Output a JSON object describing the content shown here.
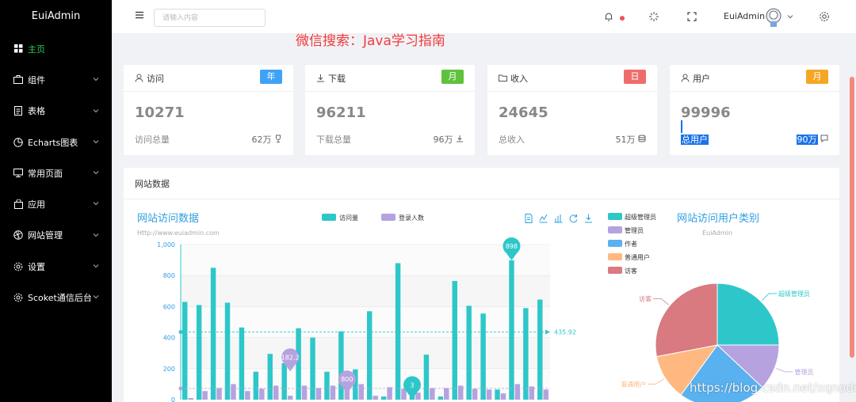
{
  "app": {
    "name": "EuiAdmin"
  },
  "sidebar": {
    "items": [
      {
        "label": "主页",
        "icon": "grid-icon",
        "active": true
      },
      {
        "label": "组件",
        "icon": "briefcase-icon"
      },
      {
        "label": "表格",
        "icon": "table-icon"
      },
      {
        "label": "Echarts图表",
        "icon": "pie-chart-icon"
      },
      {
        "label": "常用页面",
        "icon": "monitor-icon"
      },
      {
        "label": "应用",
        "icon": "bag-icon"
      },
      {
        "label": "网站管理",
        "icon": "aperture-icon"
      },
      {
        "label": "设置",
        "icon": "gear-icon"
      },
      {
        "label": "Scoket通信后台",
        "icon": "settings-icon"
      }
    ],
    "active_color": "#2ccd4f",
    "background": "#000000"
  },
  "header": {
    "search_placeholder": "请输入内容",
    "user_name": "EuiAdmin",
    "notice_dot_color": "#f0505a"
  },
  "banner_text": "微信搜索：Java学习指南",
  "stats": [
    {
      "title": "访问",
      "icon": "user-icon",
      "tag": "年",
      "tag_color": "#3fa2f7",
      "value": "10271",
      "label": "访问总量",
      "sub_value": "62万",
      "sub_icon": "trophy-icon"
    },
    {
      "title": "下载",
      "icon": "download-icon",
      "tag": "月",
      "tag_color": "#5fc23d",
      "value": "96211",
      "label": "下载总量",
      "sub_value": "96万",
      "sub_icon": "download-icon"
    },
    {
      "title": "收入",
      "icon": "folder-icon",
      "tag": "日",
      "tag_color": "#f06c6c",
      "value": "24645",
      "label": "总收入",
      "sub_value": "51万",
      "sub_icon": "database-icon"
    },
    {
      "title": "用户",
      "icon": "user-icon",
      "tag": "月",
      "tag_color": "#f5a623",
      "value": "99996",
      "label": "总用户",
      "sub_value": "90万",
      "sub_icon": "message-icon"
    }
  ],
  "panel": {
    "title": "网站数据"
  },
  "bar_chart": {
    "title": "网站访问数据",
    "subtitle": "Http://www.euiadmin.com",
    "legend": [
      "访问量",
      "登录人数"
    ],
    "toolbox_icons": [
      "data-view-icon",
      "line-chart-icon",
      "bar-chart-icon",
      "restore-icon",
      "save-image-icon"
    ],
    "avg_label": "435.92",
    "markers": [
      {
        "label": "898",
        "color": "#2ec7c9"
      },
      {
        "label": "182.2",
        "color": "#b6a2de"
      },
      {
        "label": "800",
        "color": "#b6a2de"
      },
      {
        "label": "3",
        "color": "#2ec7c9"
      }
    ]
  },
  "pie_chart": {
    "title": "网站访问用户类别",
    "subtitle": "EuiAdmin",
    "legend": [
      {
        "name": "超级管理员",
        "color": "#2ec7c9"
      },
      {
        "name": "管理员",
        "color": "#b6a2de"
      },
      {
        "name": "作者",
        "color": "#5ab1ef"
      },
      {
        "name": "普通用户",
        "color": "#ffb980"
      },
      {
        "name": "访客",
        "color": "#d87a80"
      }
    ]
  },
  "chart_data": [
    {
      "type": "bar",
      "title": "网站访问数据",
      "ylim": [
        0,
        1000
      ],
      "yticks": [
        "0",
        "200",
        "400",
        "600",
        "800",
        "1,000"
      ],
      "series": [
        {
          "name": "访问量",
          "color": "#2ec7c9",
          "values": [
            630,
            610,
            850,
            625,
            465,
            180,
            295,
            235,
            460,
            400,
            180,
            440,
            195,
            570,
            20,
            880,
            50,
            290,
            20,
            765,
            605,
            555,
            65,
            898,
            590,
            645
          ]
        },
        {
          "name": "登录人数",
          "color": "#b6a2de",
          "values": [
            10,
            55,
            75,
            100,
            55,
            70,
            90,
            25,
            90,
            75,
            90,
            100,
            100,
            25,
            80,
            70,
            45,
            75,
            75,
            90,
            70,
            65,
            40,
            100,
            85,
            65
          ]
        }
      ],
      "markline_average": 435.92
    },
    {
      "type": "pie",
      "title": "网站访问用户类别",
      "categories": [
        "超级管理员",
        "管理员",
        "作者",
        "普通用户",
        "访客"
      ],
      "values": [
        25,
        12,
        23,
        12,
        28
      ]
    }
  ],
  "watermark": "https://blog.csdn.net/xqnode"
}
